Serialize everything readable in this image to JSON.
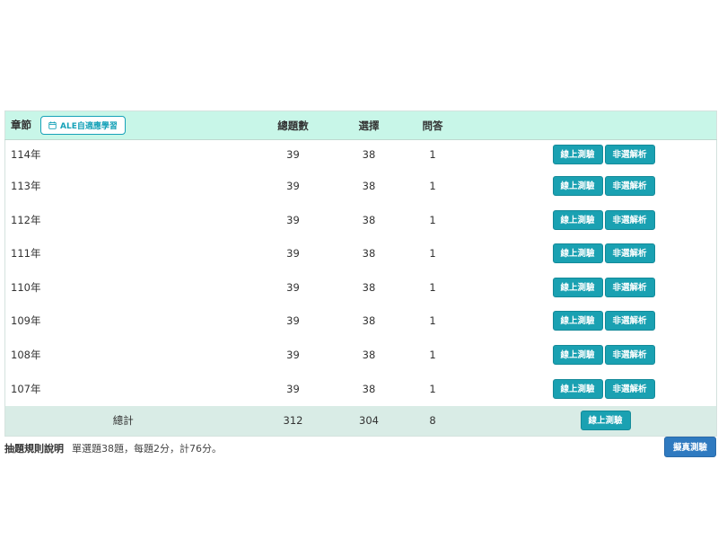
{
  "table": {
    "headers": {
      "chapter": "章節",
      "ale_button": "ALE自適應學習",
      "total": "總題數",
      "choice": "選擇",
      "qa": "問答"
    },
    "rows": [
      {
        "year": "114年",
        "total": "39",
        "choice": "38",
        "qa": "1"
      },
      {
        "year": "113年",
        "total": "39",
        "choice": "38",
        "qa": "1"
      },
      {
        "year": "112年",
        "total": "39",
        "choice": "38",
        "qa": "1"
      },
      {
        "year": "111年",
        "total": "39",
        "choice": "38",
        "qa": "1"
      },
      {
        "year": "110年",
        "total": "39",
        "choice": "38",
        "qa": "1"
      },
      {
        "year": "109年",
        "total": "39",
        "choice": "38",
        "qa": "1"
      },
      {
        "year": "108年",
        "total": "39",
        "choice": "38",
        "qa": "1"
      },
      {
        "year": "107年",
        "total": "39",
        "choice": "38",
        "qa": "1"
      }
    ],
    "row_buttons": {
      "online_test": "線上測驗",
      "non_choice_analysis": "非選解析"
    },
    "footer": {
      "label": "總計",
      "total": "312",
      "choice": "304",
      "qa": "8",
      "online_test": "線上測驗"
    }
  },
  "rules": {
    "title": "抽題規則說明",
    "text": "單選題38題，每題2分，計76分。"
  },
  "mock_exam_button": "擬真測驗",
  "icons": {
    "ale": "calendar-icon"
  },
  "colors": {
    "header_bg": "#c8f6e8",
    "footer_bg": "#d9ece6",
    "teal_button": "#1aa1b2",
    "blue_button": "#2f7ac0"
  }
}
